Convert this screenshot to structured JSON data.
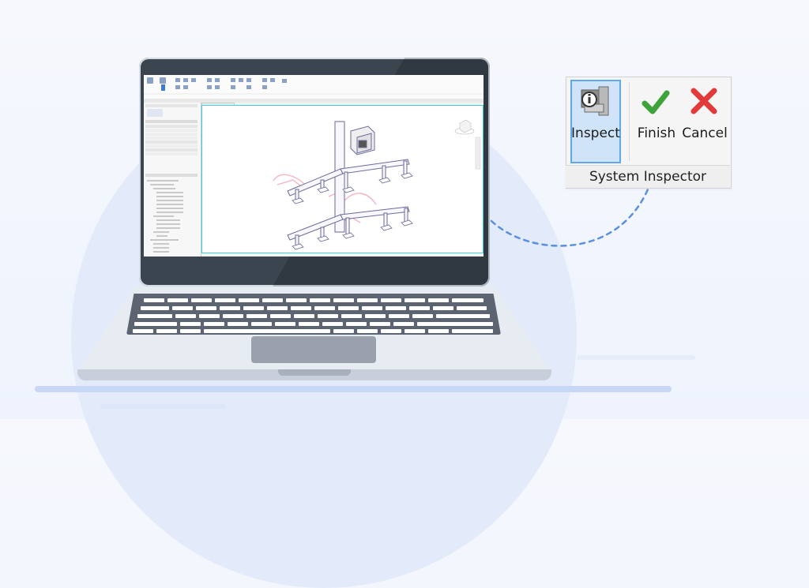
{
  "toolbar": {
    "inspect_label": "Inspect",
    "finish_label": "Finish",
    "cancel_label": "Cancel",
    "panel_title": "System Inspector"
  },
  "icons": {
    "inspect": "inspect-pipe-icon",
    "finish": "checkmark-icon",
    "cancel": "x-mark-icon"
  },
  "colors": {
    "accent": "#5fa9e8",
    "finish": "#3ea43a",
    "cancel": "#e23a3a",
    "connector": "#5b8fe0",
    "viewport_border": "#3dd1e0"
  }
}
